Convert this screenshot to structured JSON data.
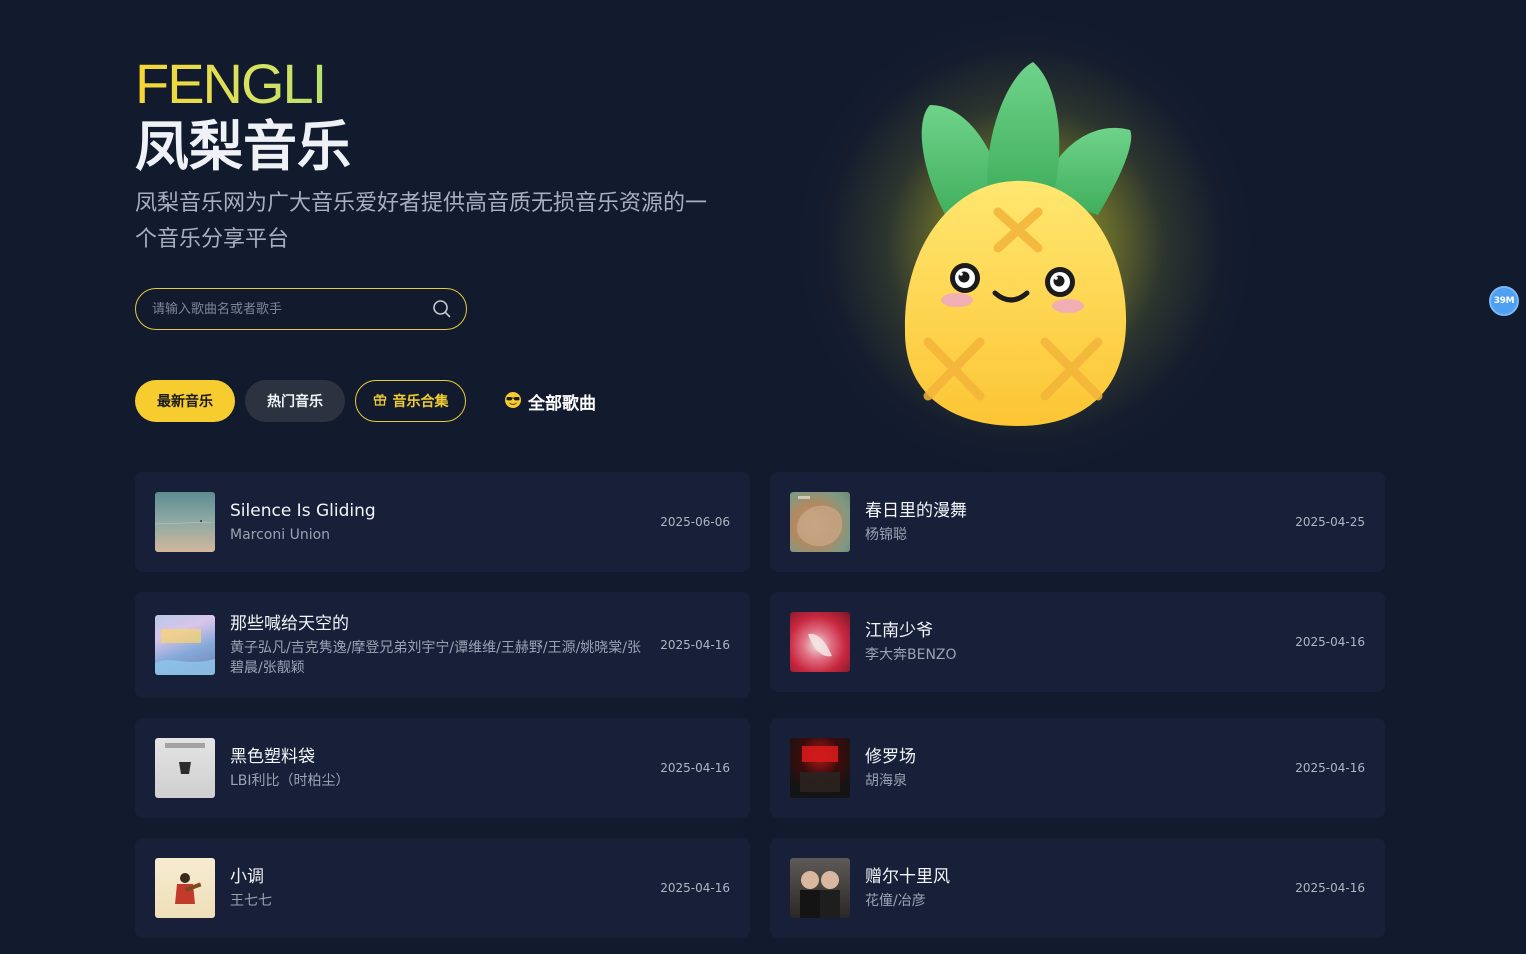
{
  "hero": {
    "brand_en": "FENGLI",
    "brand_cn": "凤梨音乐",
    "intro": "凤梨音乐网为广大音乐爱好者提供高音质无损音乐资源的一个音乐分享平台"
  },
  "search": {
    "placeholder": "请输入歌曲名或者歌手"
  },
  "filters": {
    "latest": "最新音乐",
    "hot": "热门音乐",
    "collection": "音乐合集",
    "all": "全部歌曲"
  },
  "badge": {
    "label": "39M"
  },
  "songs": [
    {
      "title": "Silence Is Gliding",
      "artist": "Marconi Union",
      "date": "2025-06-06"
    },
    {
      "title": "春日里的漫舞",
      "artist": "杨锦聪",
      "date": "2025-04-25"
    },
    {
      "title": "那些喊给天空的",
      "artist": "黄子弘凡/吉克隽逸/摩登兄弟刘宇宁/谭维维/王赫野/王源/姚晓棠/张碧晨/张靓颖",
      "date": "2025-04-16"
    },
    {
      "title": "江南少爷",
      "artist": "李大奔BENZO",
      "date": "2025-04-16"
    },
    {
      "title": "黑色塑料袋",
      "artist": "LBI利比（时柏尘）",
      "date": "2025-04-16"
    },
    {
      "title": "修罗场",
      "artist": "胡海泉",
      "date": "2025-04-16"
    },
    {
      "title": "小调",
      "artist": "王七七",
      "date": "2025-04-16"
    },
    {
      "title": "赠尔十里风",
      "artist": "花僮/冶彦",
      "date": "2025-04-16"
    }
  ],
  "colors": {
    "accent": "#f6cc2e",
    "background": "#121a2d",
    "card": "#172038",
    "badge": "#4fa0f2"
  },
  "icons": {
    "search": "search-icon",
    "collection": "gift-icon",
    "all_songs": "sunglasses-emoji-icon",
    "mascot": "pineapple-mascot"
  }
}
